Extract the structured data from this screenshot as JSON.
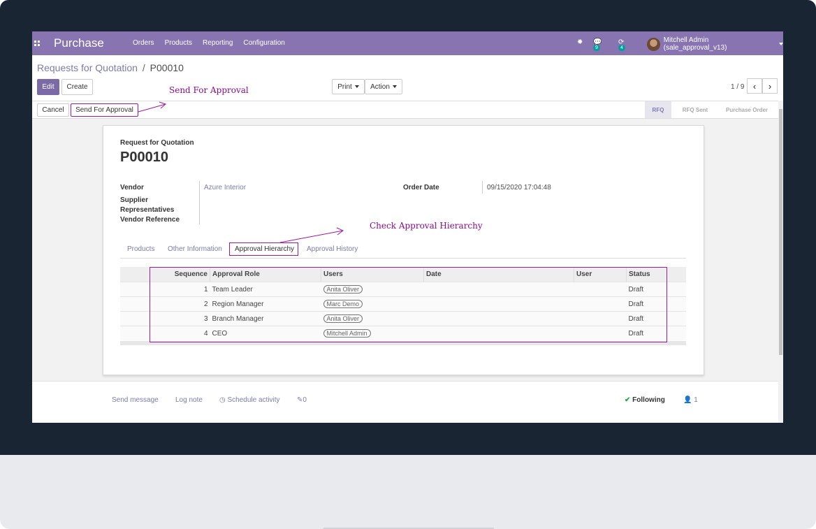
{
  "app": {
    "name": "Purchase"
  },
  "nav": {
    "menu": [
      "Orders",
      "Products",
      "Reporting",
      "Configuration"
    ],
    "chat_badge": "9",
    "activity_badge": "4",
    "user": "Mitchell Admin (sale_approval_v13)"
  },
  "breadcrumb": {
    "parent": "Requests for Quotation",
    "separator": "/",
    "current": "P00010"
  },
  "buttons": {
    "edit": "Edit",
    "create": "Create",
    "print": "Print",
    "action": "Action",
    "cancel": "Cancel",
    "send_for_approval": "Send For Approval"
  },
  "pager": {
    "text": "1 / 9"
  },
  "annotations": {
    "send": "Send For Approval",
    "check": "Check Approval Hierarchy"
  },
  "stages": [
    "RFQ",
    "RFQ Sent",
    "Purchase Order"
  ],
  "form": {
    "subtitle": "Request for Quotation",
    "title": "P00010",
    "vendor_label": "Vendor",
    "vendor_value": "Azure Interior",
    "supplier_label_1": "Supplier",
    "supplier_label_2": "Representatives",
    "vendor_ref_label": "Vendor Reference",
    "order_date_label": "Order Date",
    "order_date_value": "09/15/2020 17:04:48"
  },
  "tabs": [
    "Products",
    "Other Information",
    "Approval Hierarchy",
    "Approval History"
  ],
  "table": {
    "headers": [
      "Sequence",
      "Approval Role",
      "Users",
      "Date",
      "User",
      "Status"
    ],
    "rows": [
      {
        "seq": "1",
        "role": "Team Leader",
        "users": "Anita Oliver",
        "date": "",
        "user": "",
        "status": "Draft"
      },
      {
        "seq": "2",
        "role": "Region Manager",
        "users": "Marc Demo",
        "date": "",
        "user": "",
        "status": "Draft"
      },
      {
        "seq": "3",
        "role": "Branch Manager",
        "users": "Anita Oliver",
        "date": "",
        "user": "",
        "status": "Draft"
      },
      {
        "seq": "4",
        "role": "CEO",
        "users": "Mitchell Admin",
        "date": "",
        "user": "",
        "status": "Draft"
      }
    ]
  },
  "chatter": {
    "send_message": "Send message",
    "log_note": "Log note",
    "schedule": "Schedule activity",
    "attachments": "0",
    "following": "Following",
    "followers": "1"
  },
  "colors": {
    "primary": "#8774b0",
    "annotation": "#8b0a8b",
    "link": "#7c7bad"
  }
}
